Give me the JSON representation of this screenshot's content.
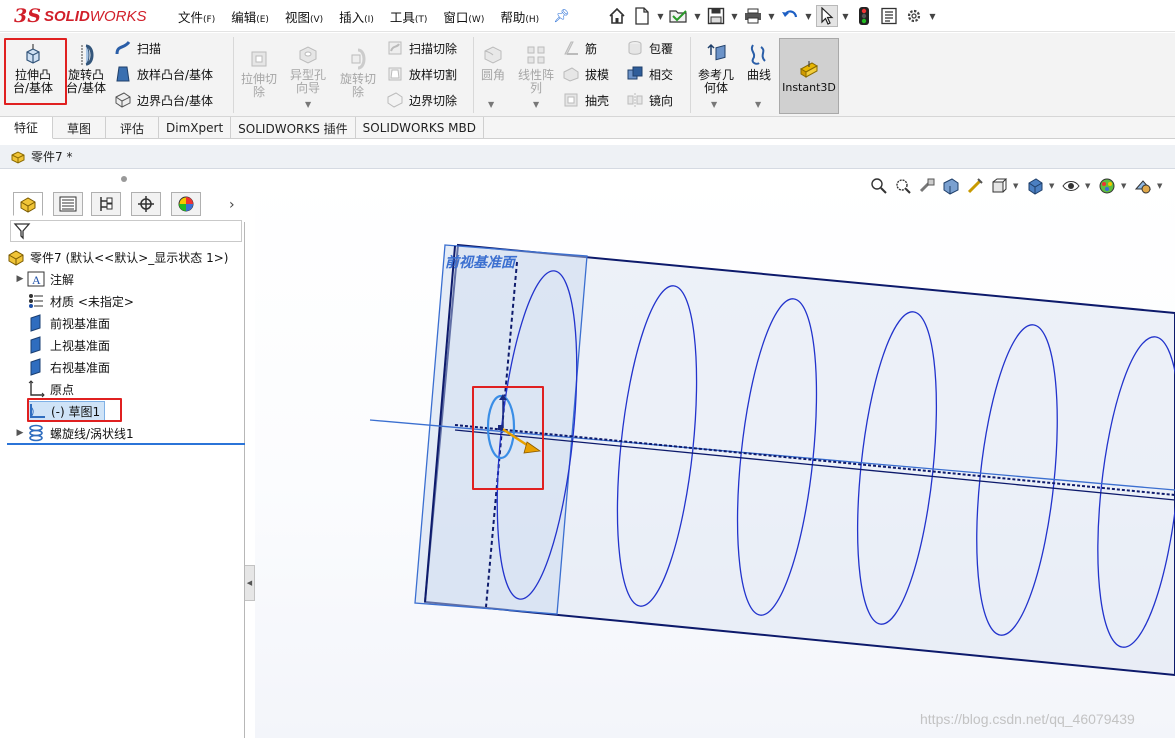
{
  "app": {
    "logo_ds": "3S",
    "logo_name": "SOLID",
    "logo_name2": "WORKS"
  },
  "menu": [
    {
      "label": "文件",
      "key": "(F)"
    },
    {
      "label": "编辑",
      "key": "(E)"
    },
    {
      "label": "视图",
      "key": "(V)"
    },
    {
      "label": "插入",
      "key": "(I)"
    },
    {
      "label": "工具",
      "key": "(T)"
    },
    {
      "label": "窗口",
      "key": "(W)"
    },
    {
      "label": "帮助",
      "key": "(H)"
    }
  ],
  "quick_access_icons": [
    "home-icon",
    "new-document-icon",
    "open-folder-icon",
    "save-icon",
    "print-icon",
    "undo-icon",
    "select-cursor-icon",
    "traffic-light-icon",
    "file-properties-icon",
    "options-gear-icon"
  ],
  "ribbon": {
    "extrude_boss": "拉伸凸\n台/基体",
    "revolve_boss": "旋转凸\n台/基体",
    "sweep": "扫描",
    "loft_boss": "放样凸台/基体",
    "boundary_boss": "边界凸台/基体",
    "extrude_cut": "拉伸切\n除",
    "hole_wizard": "异型孔\n向导",
    "revolve_cut": "旋转切\n除",
    "sweep_cut": "扫描切除",
    "loft_cut": "放样切割",
    "boundary_cut": "边界切除",
    "fillet": "圆角",
    "linear_pattern": "线性阵\n列",
    "rib": "筋",
    "draft": "拔模",
    "shell": "抽壳",
    "wrap": "包覆",
    "intersect": "相交",
    "mirror": "镜向",
    "ref_geometry": "参考几\n何体",
    "curves": "曲线",
    "instant3d": "Instant3D"
  },
  "tabs": [
    "特征",
    "草图",
    "评估",
    "DimXpert",
    "SOLIDWORKS 插件",
    "SOLIDWORKS MBD"
  ],
  "document": {
    "title": "零件7 *"
  },
  "tree": {
    "root": "零件7  (默认<<默认>_显示状态 1>)",
    "items": [
      {
        "label": "注解",
        "icon": "annotations-icon",
        "expandable": true
      },
      {
        "label": "材质 <未指定>",
        "icon": "material-icon",
        "expandable": false
      },
      {
        "label": "前视基准面",
        "icon": "plane-icon",
        "expandable": false
      },
      {
        "label": "上视基准面",
        "icon": "plane-icon",
        "expandable": false
      },
      {
        "label": "右视基准面",
        "icon": "plane-icon",
        "expandable": false
      },
      {
        "label": "原点",
        "icon": "origin-icon",
        "expandable": false
      },
      {
        "label": "(-) 草图1",
        "icon": "sketch-icon",
        "expandable": false,
        "selected": true
      },
      {
        "label": "螺旋线/涡状线1",
        "icon": "helix-icon",
        "expandable": true
      }
    ]
  },
  "viewport": {
    "plane_label": "前视基准面",
    "watermark": "https://blog.csdn.net/qq_46079439"
  },
  "colors": {
    "accent_red": "#e02020",
    "helix_blue": "#2233cc",
    "selection_blue": "#3a8ee6",
    "brand_red": "#d11f2a"
  }
}
